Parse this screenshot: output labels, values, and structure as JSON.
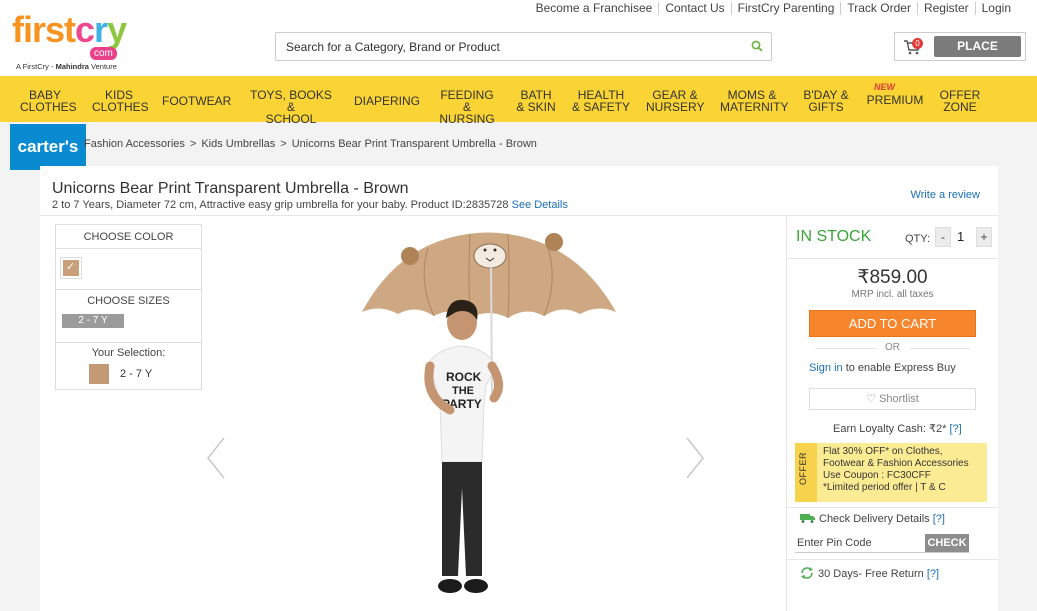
{
  "header": {
    "logo": {
      "part1": "first",
      "part2": "c",
      "part3": "r",
      "part4": "y",
      "com": "com",
      "tagline_prefix": "A FirstCry - ",
      "tagline_brand": "Mahindra",
      "tagline_suffix": " Venture"
    },
    "top_links": [
      "Become a Franchisee",
      "Contact Us",
      "FirstCry Parenting",
      "Track Order",
      "Register",
      "Login"
    ],
    "search_placeholder": "Search for a Category, Brand or Product",
    "cart_count": "0",
    "place_order": "PLACE ORDER"
  },
  "nav": {
    "items": [
      {
        "label1": "BABY",
        "label2": "CLOTHES"
      },
      {
        "label1": "KIDS",
        "label2": "CLOTHES"
      },
      {
        "label1": "FOOTWEAR",
        "label2": ""
      },
      {
        "label1": "TOYS, BOOKS &",
        "label2": "SCHOOL"
      },
      {
        "label1": "DIAPERING",
        "label2": ""
      },
      {
        "label1": "FEEDING &",
        "label2": "NURSING"
      },
      {
        "label1": "BATH",
        "label2": "& SKIN"
      },
      {
        "label1": "HEALTH",
        "label2": "& SAFETY"
      },
      {
        "label1": "GEAR &",
        "label2": "NURSERY"
      },
      {
        "label1": "MOMS &",
        "label2": "MATERNITY"
      },
      {
        "label1": "B'DAY &",
        "label2": "GIFTS"
      },
      {
        "label1": "PREMIUM",
        "label2": ""
      },
      {
        "label1": "OFFER",
        "label2": "ZONE"
      }
    ],
    "new_badge": "NEW"
  },
  "brand_badge": "carter's",
  "breadcrumb": [
    "Fashion Accessories",
    "Kids Umbrellas",
    "Unicorns Bear Print Transparent Umbrella - Brown"
  ],
  "product": {
    "title": "Unicorns Bear Print Transparent Umbrella - Brown",
    "description": "2 to 7 Years, Diameter 72 cm, Attractive easy grip umbrella for your baby. Product ID:2835728",
    "see_details": "See Details",
    "write_review": "Write a review",
    "choose_color": "CHOOSE COLOR",
    "choose_sizes": "CHOOSE SIZES",
    "size_option": "2 - 7 Y",
    "your_selection": "Your Selection:",
    "selected_size": "2 - 7 Y",
    "image_text": {
      "line1": "ROCK",
      "line2": "THE",
      "line3": "PARTY"
    }
  },
  "buy_box": {
    "stock": "IN STOCK",
    "qty_label": "QTY:",
    "qty": "1",
    "minus": "-",
    "plus": "+",
    "price": "₹859.00",
    "mrp_note": "MRP incl. all taxes",
    "add_to_cart": "ADD TO CART",
    "or": "OR",
    "sign_in": "Sign in",
    "sign_in_suffix": " to enable Express Buy",
    "shortlist": "♡ Shortlist",
    "loyalty_label": "Earn Loyalty Cash: ₹2*",
    "loyalty_help": "[?]",
    "offer_tag": "OFFER",
    "offer_line1": "Flat 30% OFF* on Clothes, Footwear & Fashion Accessories",
    "offer_line2": "Use Coupon : FC30CFF",
    "offer_line3": "*Limited period offer | T & C",
    "delivery_label": "Check Delivery Details",
    "delivery_help": "[?]",
    "pin_placeholder": "Enter Pin Code",
    "check": "CHECK",
    "returns_label": "30 Days- Free Return",
    "returns_help": "[?]"
  },
  "colors": {
    "nav_bg": "#f9d434",
    "add_cart": "#f7852b",
    "stock_green": "#3aa33a",
    "link_blue": "#1a6fb8",
    "brand_blue": "#0a8ad1"
  }
}
